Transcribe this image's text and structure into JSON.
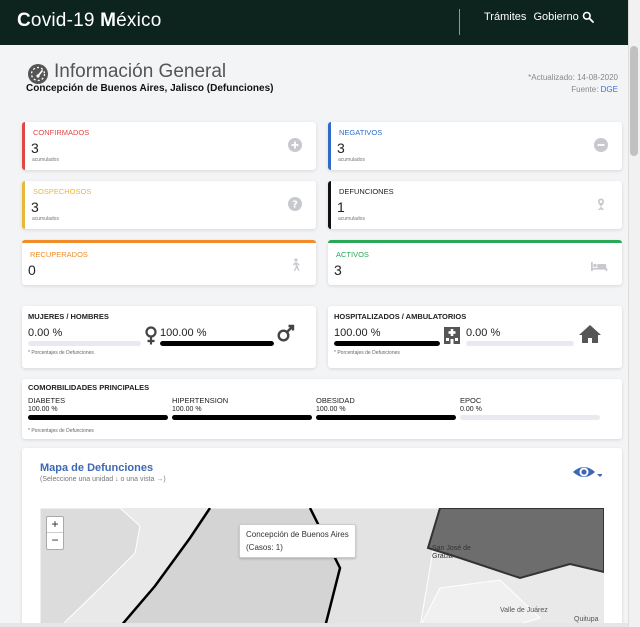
{
  "header": {
    "brand_first": "C",
    "brand_mid": "ovid-19 ",
    "brand_bold": "M",
    "brand_rest": "éxico",
    "nav": [
      "Trámites",
      "Gobierno"
    ]
  },
  "info": {
    "title": "Información General",
    "subtitle": "Concepción de Buenos Aires, Jalisco (Defunciones)",
    "updated_label": "*Actualizado: 14-08-2020",
    "source_label": "Fuente: ",
    "source_link": "DGE"
  },
  "stats": {
    "confirmados": {
      "label": "CONFIRMADOS",
      "value": "3",
      "sub": "acumulados",
      "color": "#e04848",
      "icon": "plus-circle-icon"
    },
    "negativos": {
      "label": "NEGATIVOS",
      "value": "3",
      "sub": "acumulados",
      "color": "#2e6cc7",
      "icon": "minus-circle-icon"
    },
    "sospechosos": {
      "label": "SOSPECHOSOS",
      "value": "3",
      "sub": "acumulados",
      "color": "#e7b83a",
      "icon": "question-circle-icon"
    },
    "defunciones": {
      "label": "DEFUNCIONES",
      "value": "1",
      "sub": "acumulados",
      "color": "#111111",
      "icon": "ribbon-icon"
    },
    "recuperados": {
      "label": "RECUPERADOS",
      "value": "0",
      "color": "#f08c2a",
      "icon": "walking-icon"
    },
    "activos": {
      "label": "ACTIVOS",
      "value": "3",
      "color": "#2aa856",
      "icon": "bed-icon"
    }
  },
  "gender": {
    "label": "MUJERES / HOMBRES",
    "women_pct": "0.00 %",
    "men_pct": "100.00 %",
    "women_fraction": 0.0,
    "men_fraction": 1.0,
    "note": "* Porcentajes  de Defunciones"
  },
  "hospital": {
    "label": "HOSPITALIZADOS / AMBULATORIOS",
    "hosp_pct": "100.00 %",
    "amb_pct": "0.00 %",
    "hosp_fraction": 1.0,
    "amb_fraction": 0.0,
    "note": "* Porcentajes  de Defunciones"
  },
  "comorbidities": {
    "label": "COMORBILIDADES PRINCIPALES",
    "items": [
      {
        "name": "DIABETES",
        "value": "100.00 %",
        "fraction": 1.0
      },
      {
        "name": "HIPERTENSION",
        "value": "100.00 %",
        "fraction": 1.0
      },
      {
        "name": "OBESIDAD",
        "value": "100.00 %",
        "fraction": 1.0
      },
      {
        "name": "EPOC",
        "value": "0.00 %",
        "fraction": 0.0
      }
    ],
    "note": "* Porcentajes  de Defunciones"
  },
  "map": {
    "title": "Mapa de Defunciones",
    "subtitle": "(Seleccione una unidad ↓ o una vista →)",
    "zoom_in": "+",
    "zoom_out": "−",
    "tooltip_line1": "Concepción de Buenos Aires",
    "tooltip_line2": "(Casos: 1)",
    "places": [
      "San José de Gracia",
      "Valle de Juárez",
      "Quitupa"
    ]
  }
}
